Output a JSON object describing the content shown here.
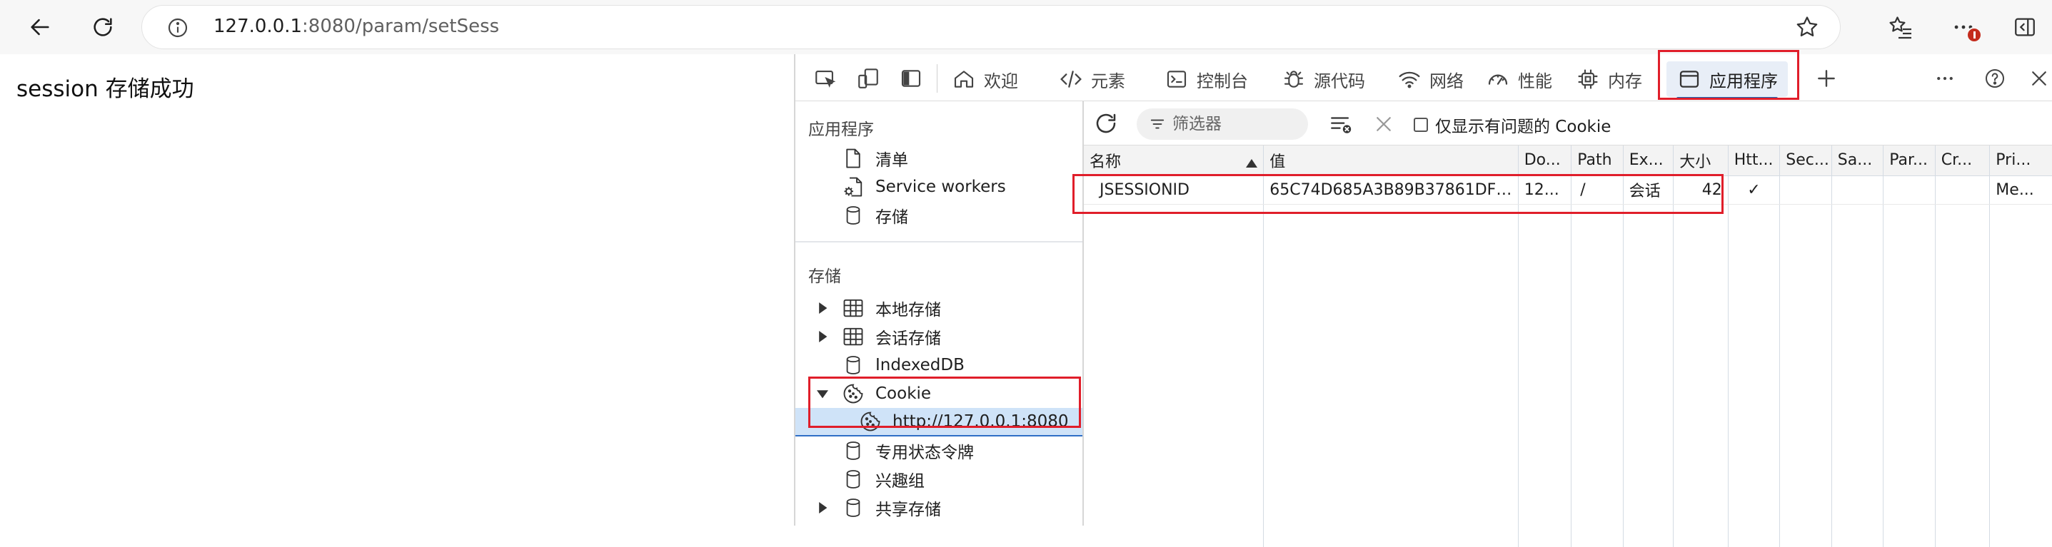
{
  "browser": {
    "url_host": "127.0.0.1",
    "url_rest": ":8080/param/setSess"
  },
  "page": {
    "message": "session 存储成功"
  },
  "devtools": {
    "tabs": {
      "welcome": "欢迎",
      "elements": "元素",
      "console": "控制台",
      "sources": "源代码",
      "network": "网络",
      "performance": "性能",
      "memory": "内存",
      "application": "应用程序"
    },
    "active_tab": "应用程序",
    "sidebar": {
      "app_section": "应用程序",
      "app_items": {
        "manifest": "清单",
        "service_workers": "Service workers",
        "storage": "存储"
      },
      "storage_section": "存储",
      "storage_items": {
        "local_storage": "本地存储",
        "session_storage": "会话存储",
        "indexeddb": "IndexedDB",
        "cookie": "Cookie",
        "cookie_host": "http://127.0.0.1:8080",
        "private_state_tokens": "专用状态令牌",
        "interest_groups": "兴趣组",
        "shared_storage": "共享存储"
      }
    },
    "cookie_toolbar": {
      "filter_placeholder": "筛选器",
      "issues_only_label": "仅显示有问题的 Cookie"
    },
    "cookie_table": {
      "columns": {
        "name": "名称",
        "value": "值",
        "domain": "Do...",
        "path": "Path",
        "expires": "Ex...",
        "size": "大小",
        "httponly": "Htt...",
        "secure": "Sec...",
        "samesite": "Sa...",
        "partition": "Par...",
        "cross_site": "Cr...",
        "priority": "Pri..."
      },
      "rows": [
        {
          "name": "JSESSIONID",
          "value": "65C74D685A3B89B37861DFD...",
          "domain": "12...",
          "path": "/",
          "expires": "会话",
          "size": "42",
          "httponly": "✓",
          "secure": "",
          "samesite": "",
          "partition": "",
          "cross_site": "",
          "priority": "Me..."
        }
      ]
    },
    "highlight_color": "#e01e2a",
    "accent_color": "#0f6cbd"
  }
}
